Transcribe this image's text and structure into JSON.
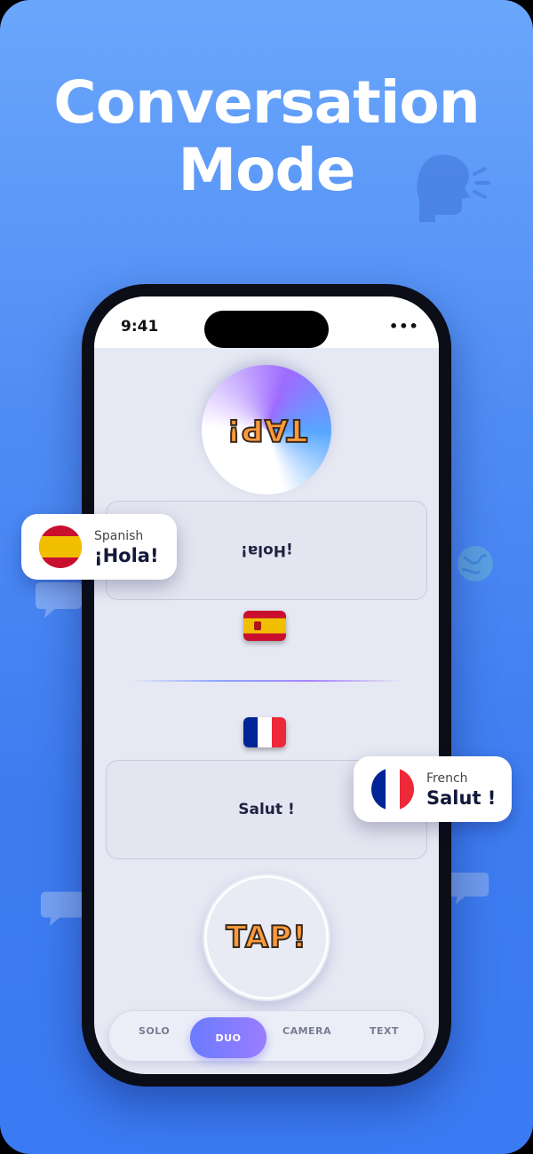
{
  "headline": {
    "line1": "Conversation",
    "line2": "Mode"
  },
  "status_bar": {
    "time": "9:41",
    "menu": "•••"
  },
  "top_speaker": {
    "tap_label": "TAP!",
    "message": "¡Hola!"
  },
  "bottom_speaker": {
    "tap_label": "TAP!",
    "message": "Salut !"
  },
  "tabs": {
    "solo": "SOLO",
    "duo": "DUO",
    "camera": "CAMERA",
    "text": "TEXT",
    "active": "DUO"
  },
  "badges": {
    "spanish": {
      "language": "Spanish",
      "word": "¡Hola!"
    },
    "french": {
      "language": "French",
      "word": "Salut !"
    }
  },
  "icons": [
    "speaking-head-icon",
    "globe-icon",
    "speech-bubble-icon",
    "spain-flag-icon",
    "france-flag-icon"
  ],
  "colors": {
    "background_top": "#6aa6fb",
    "background_bottom": "#3a7af2",
    "tap_text": "#ff9a3c",
    "tab_active": "#7b7cff"
  }
}
